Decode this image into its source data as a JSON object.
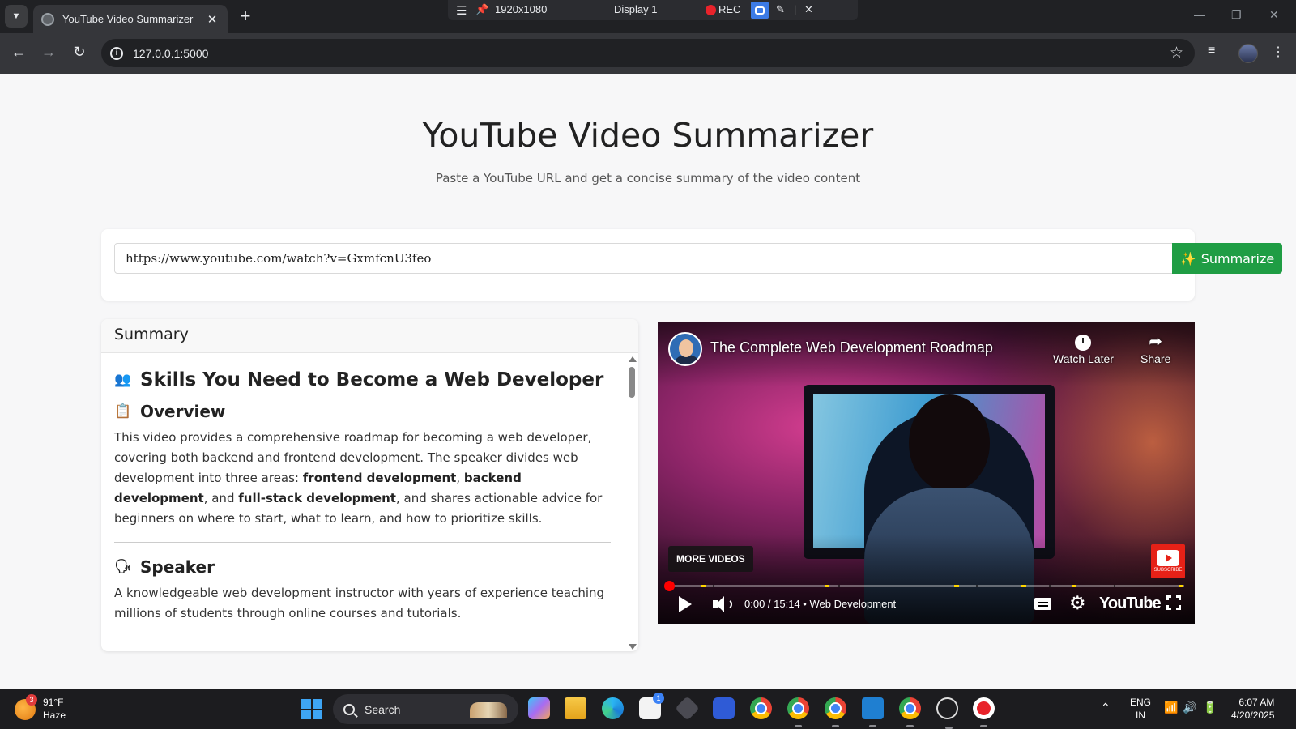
{
  "browser": {
    "tab_title": "YouTube Video Summarizer",
    "new_tab": "+",
    "url": "127.0.0.1:5000"
  },
  "recorder": {
    "resolution": "1920x1080",
    "display": "Display 1",
    "rec_label": "REC"
  },
  "page": {
    "title": "YouTube Video Summarizer",
    "subtitle": "Paste a YouTube URL and get a concise summary of the video content",
    "url_input_value": "https://www.youtube.com/watch?v=GxmfcnU3feo",
    "summarize_label": "Summarize",
    "summarize_emoji": "✨"
  },
  "summary": {
    "heading": "Summary",
    "main_title": "Skills You Need to Become a Web Developer",
    "main_emoji": "👥",
    "overview_emoji": "📋",
    "overview_heading": "Overview",
    "overview_p1": "This video provides a comprehensive roadmap for becoming a web developer, covering both backend and frontend development. The speaker divides web development into three areas: ",
    "overview_b1": "frontend development",
    "overview_sep1": ", ",
    "overview_b2": "backend development",
    "overview_sep2": ", and ",
    "overview_b3": "full-stack development",
    "overview_p2": ", and shares actionable advice for beginners on where to start, what to learn, and how to prioritize skills.",
    "speaker_emoji": "🗣",
    "speaker_heading": "Speaker",
    "speaker_text": "A knowledgeable web development instructor with years of experience teaching millions of students through online courses and tutorials."
  },
  "video": {
    "title": "The Complete Web Development Roadmap",
    "watch_later": "Watch Later",
    "share": "Share",
    "more_videos": "MORE VIDEOS",
    "subscribe": "SUBSCRIBE",
    "time": "0:00 / 15:14",
    "chapter": "• Web Development",
    "youtube_logo": "YouTube",
    "progress_fraction": 0
  },
  "taskbar": {
    "weather_temp": "91°F",
    "weather_desc": "Haze",
    "weather_badge": "3",
    "search_label": "Search",
    "lang_line1": "ENG",
    "lang_line2": "IN",
    "time": "6:07 AM",
    "date": "4/20/2025",
    "store_badge": "1"
  },
  "colors": {
    "accent_green": "#1f9d44",
    "progress_red": "#ff0000",
    "chapter_yellow": "#ffd600"
  }
}
